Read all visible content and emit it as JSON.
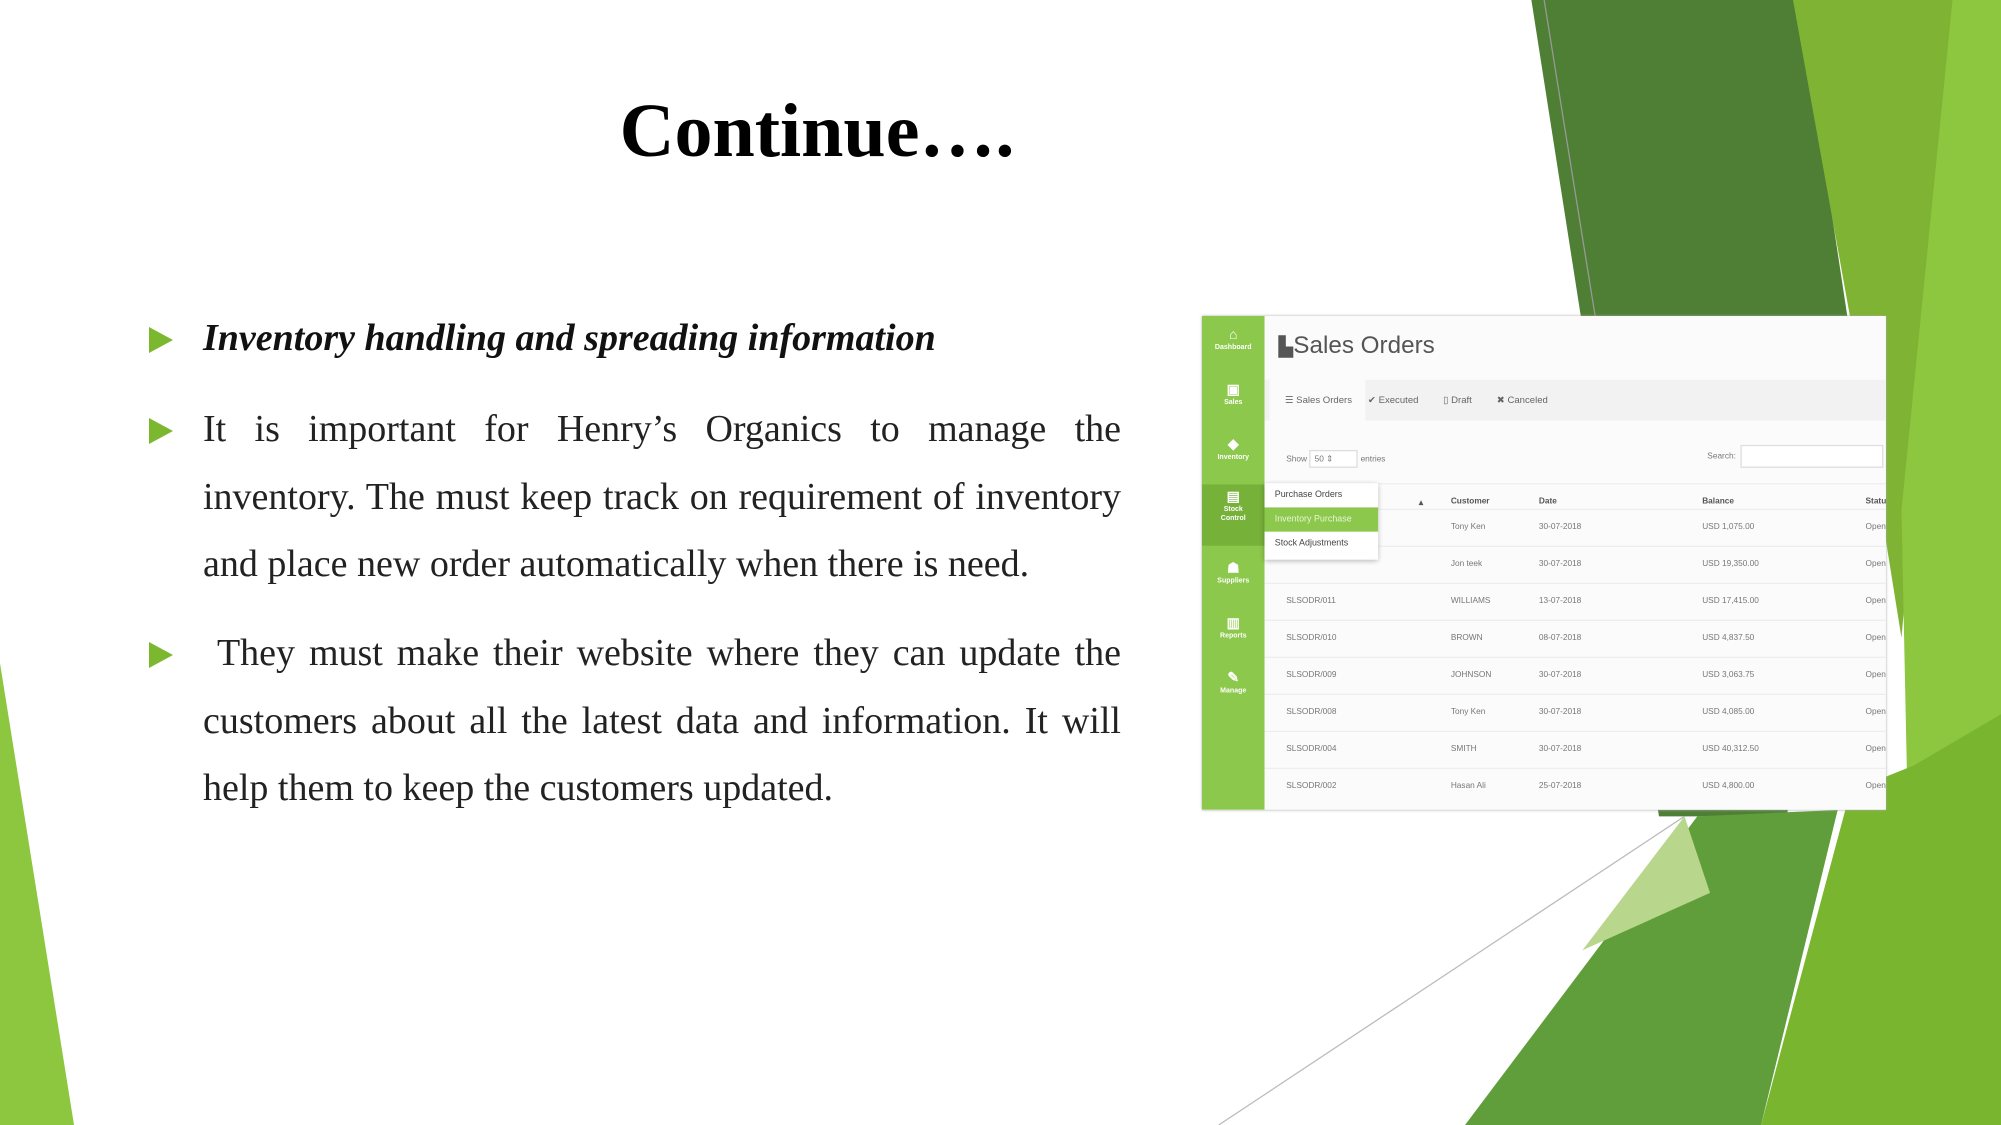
{
  "title": "Continue….",
  "bullets": [
    "Inventory handling and spreading information",
    "It is important for Henry’s Organics to manage the inventory. The must keep track on requirement of inventory and place new order automatically when there is need.",
    " They must make their website where they can update the customers about all the latest data and information. It will help them to keep the customers updated."
  ],
  "colors": {
    "accent": "#7cb82f",
    "dark_green": "#4e7f34",
    "sidebar": "#8cc84b"
  },
  "app": {
    "sidebar": [
      {
        "icon": "dashboard-icon",
        "label": "Dashboard"
      },
      {
        "icon": "money-icon",
        "label": "Sales"
      },
      {
        "icon": "tag-icon",
        "label": "Inventory"
      },
      {
        "icon": "stock-icon",
        "label": "Stock Control"
      },
      {
        "icon": "users-icon",
        "label": "Suppliers"
      },
      {
        "icon": "chart-icon",
        "label": "Reports"
      },
      {
        "icon": "wrench-icon",
        "label": "Manage"
      }
    ],
    "page_title": "Sales Orders",
    "tabs": [
      "Sales Orders",
      "Executed",
      "Draft",
      "Canceled"
    ],
    "show_label": "Show",
    "entries_value": "50",
    "entries_label": "entries",
    "search_label": "Search:",
    "dropdown": [
      "Purchase Orders",
      "Inventory Purchase",
      "Stock Adjustments"
    ],
    "columns": [
      "Customer",
      "Date",
      "Balance",
      "Status"
    ],
    "rows": [
      {
        "id": "",
        "customer": "Tony Ken",
        "date": "30-07-2018",
        "balance": "USD 1,075.00",
        "status": "Open"
      },
      {
        "id": "",
        "customer": "Jon teek",
        "date": "30-07-2018",
        "balance": "USD 19,350.00",
        "status": "Open"
      },
      {
        "id": "SLSODR/011",
        "customer": "WILLIAMS",
        "date": "13-07-2018",
        "balance": "USD 17,415.00",
        "status": "Open"
      },
      {
        "id": "SLSODR/010",
        "customer": "BROWN",
        "date": "08-07-2018",
        "balance": "USD 4,837.50",
        "status": "Open"
      },
      {
        "id": "SLSODR/009",
        "customer": "JOHNSON",
        "date": "30-07-2018",
        "balance": "USD 3,063.75",
        "status": "Open"
      },
      {
        "id": "SLSODR/008",
        "customer": "Tony Ken",
        "date": "30-07-2018",
        "balance": "USD 4,085.00",
        "status": "Open"
      },
      {
        "id": "SLSODR/004",
        "customer": "SMITH",
        "date": "30-07-2018",
        "balance": "USD 40,312.50",
        "status": "Open"
      },
      {
        "id": "SLSODR/002",
        "customer": "Hasan Ali",
        "date": "25-07-2018",
        "balance": "USD 4,800.00",
        "status": "Open"
      }
    ]
  }
}
